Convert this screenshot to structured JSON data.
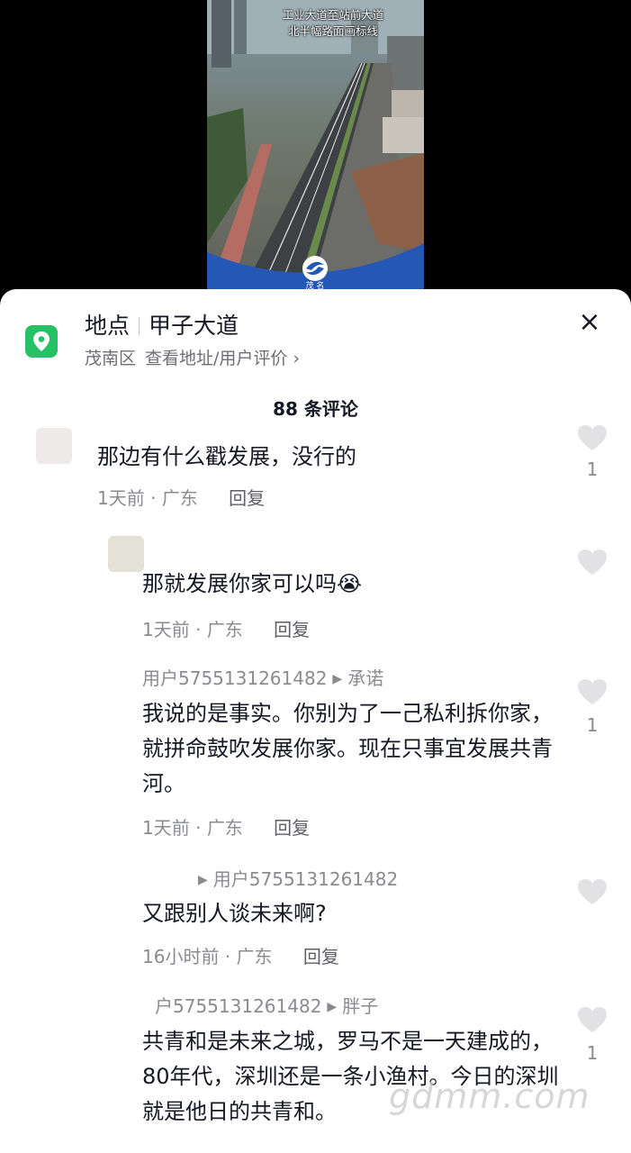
{
  "video": {
    "caption_line1": "工业大道至站前大道",
    "caption_line2": "北半幅路面画标线",
    "logo_text": "茂 名"
  },
  "location": {
    "label": "地点",
    "name": "甲子大道",
    "district": "茂南区",
    "action": "查看地址/用户评价 ›"
  },
  "close_icon": "×",
  "comments_count": "88 条评论",
  "comments": [
    {
      "username": "",
      "text": "那边有什么戳发展，没行的",
      "time": "1天前",
      "region": "广东",
      "reply": "回复",
      "likes": "1"
    },
    {
      "username": "",
      "text": "那就发展你家可以吗😭",
      "time": "1天前",
      "region": "广东",
      "reply": "回复",
      "likes": ""
    },
    {
      "username": "用户5755131261482",
      "reply_to": "承诺",
      "text": "我说的是事实。你别为了一己私利拆你家，就拼命鼓吹发展你家。现在只事宜发展共青河。",
      "time": "1天前",
      "region": "广东",
      "reply": "回复",
      "likes": "1"
    },
    {
      "username": "",
      "reply_to": "用户5755131261482",
      "text": "又跟别人谈未来啊?",
      "time": "16小时前",
      "region": "广东",
      "reply": "回复",
      "likes": ""
    },
    {
      "username": "户5755131261482",
      "reply_to": "胖子",
      "text": "共青和是未来之城，罗马不是一天建成的，80年代，深圳还是一条小渔村。今日的深圳就是他日的共青和。",
      "time": "",
      "region": "",
      "reply": "",
      "likes": "1"
    }
  ],
  "watermark": "gdmm.com",
  "colors": {
    "location_green": "#26c164",
    "text_primary": "#161823",
    "text_secondary": "#8a8b91"
  }
}
